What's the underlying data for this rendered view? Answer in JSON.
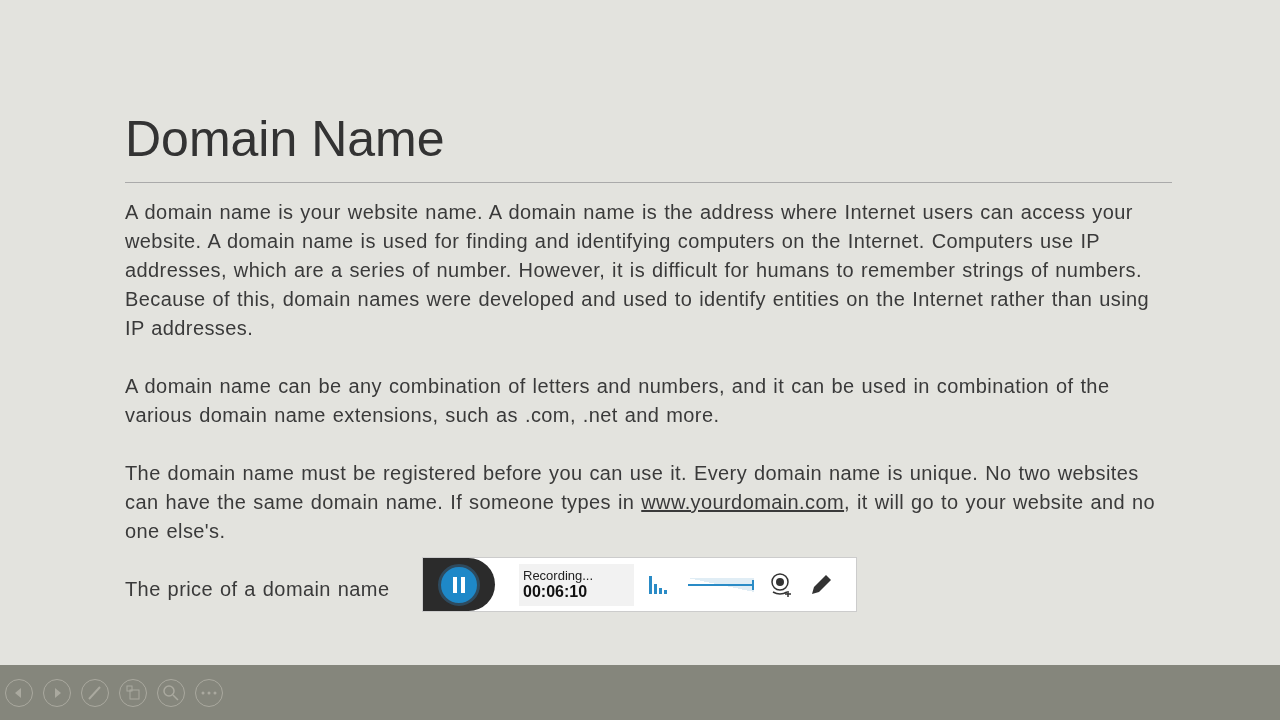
{
  "slide": {
    "title": "Domain Name",
    "paragraphs": [
      [
        {
          "kind": "text",
          "text": "A domain name is your website name. A domain name is the address where Internet users can access your website. A domain name is used for finding and identifying computers on the Internet. Computers use IP addresses, which are a series of number. However, it is difficult for humans to remember strings of numbers. Because of this, domain names were developed and used to identify entities on the Internet rather than using IP addresses."
        }
      ],
      [
        {
          "kind": "text",
          "text": "A domain name can be any combination of letters and numbers, and it can be used in combination of the various domain name extensions, such as .com, .net and more."
        }
      ],
      [
        {
          "kind": "text",
          "text": "The domain name must be registered before you can use it. Every domain name is unique. No two websites can have the same domain name. If someone types in "
        },
        {
          "kind": "link",
          "text": "www.yourdomain.com"
        },
        {
          "kind": "text",
          "text": ", it will go to your website and no one else's."
        }
      ],
      [
        {
          "kind": "text",
          "text": "The price of a domain name"
        }
      ]
    ]
  },
  "recorder": {
    "status": "Recording...",
    "time": "00:06:10",
    "volume": {
      "level": 1
    }
  }
}
